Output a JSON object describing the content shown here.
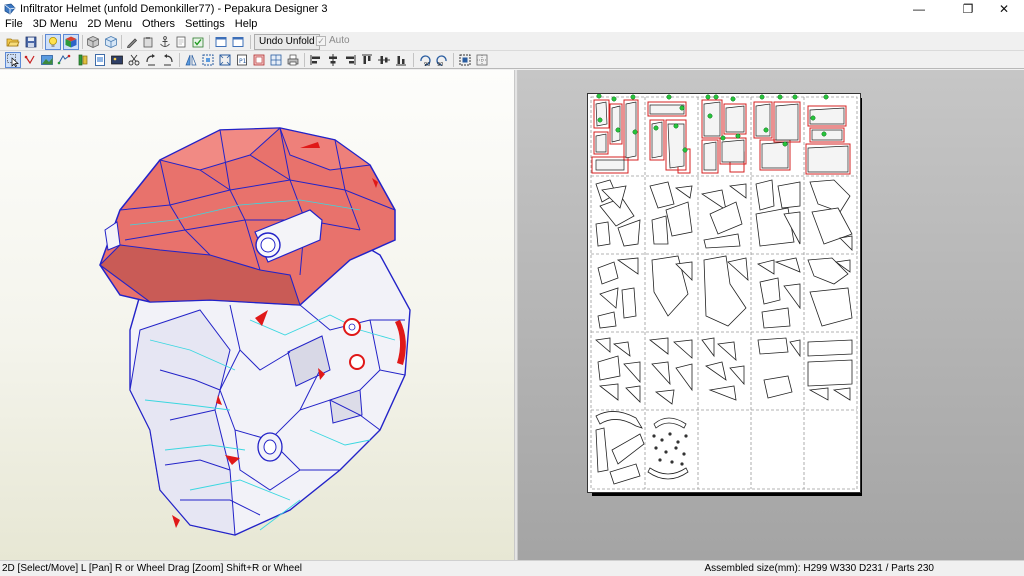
{
  "window": {
    "title": "Infiltrator Helmet (unfold Demonkiller77) - Pepakura Designer 3",
    "minimize": "—",
    "maximize": "❐",
    "close": "✕"
  },
  "menu": [
    "File",
    "3D Menu",
    "2D Menu",
    "Others",
    "Settings",
    "Help"
  ],
  "toolbar": {
    "undo_unfold_label": "Undo Unfold",
    "auto_label": "Auto",
    "auto_checked": true
  },
  "statusbar": {
    "hint": "2D [Select/Move] L [Pan] R or Wheel Drag [Zoom] Shift+R or Wheel",
    "info": "Assembled size(mm): H299 W330 D231 / Parts 230"
  },
  "colors": {
    "roof": "#e8726c",
    "mesh_edge": "#2323c8",
    "fold_line": "#3ad7e0",
    "cut_mark": "#e01818",
    "paper_grid": "#9a9a9a",
    "selection_box": "#d42020",
    "flap_node": "#27c43c"
  }
}
